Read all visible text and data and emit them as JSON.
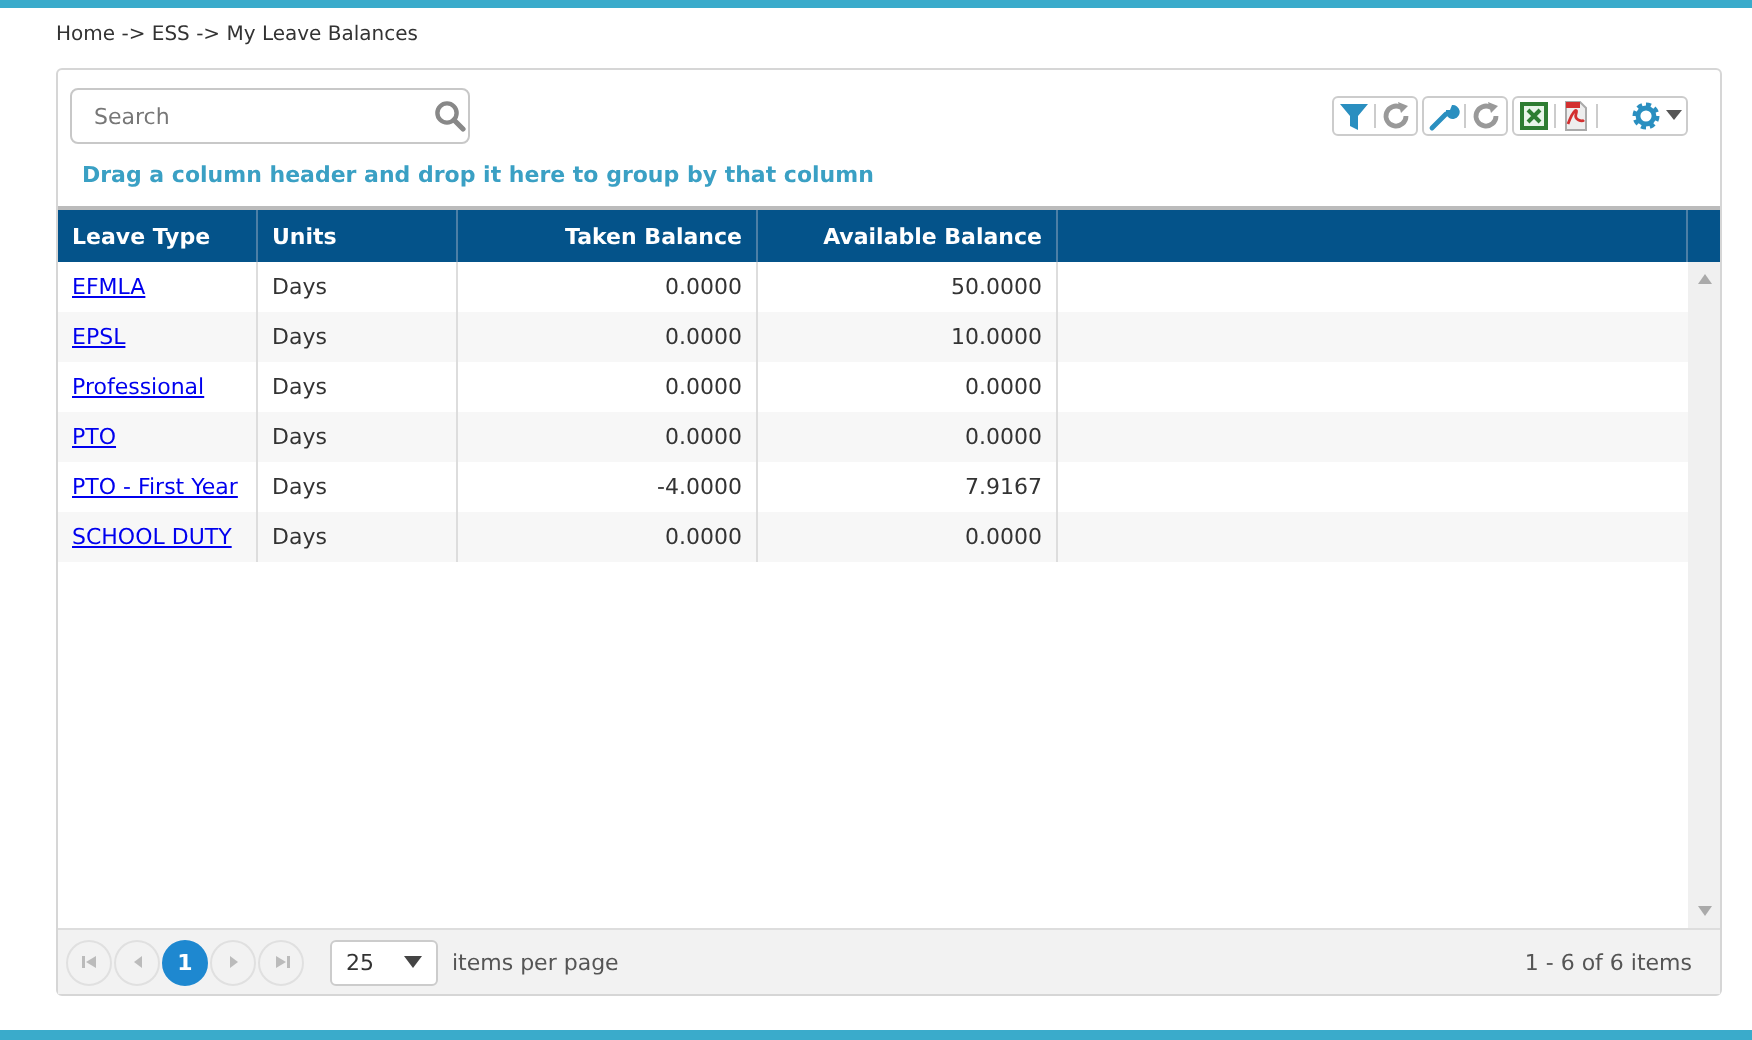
{
  "breadcrumb": "Home -> ESS -> My Leave Balances",
  "search": {
    "placeholder": "Search"
  },
  "group_hint": "Drag a column header and drop it here to group by that column",
  "table": {
    "columns": [
      {
        "label": "Leave Type",
        "numeric": false
      },
      {
        "label": "Units",
        "numeric": false
      },
      {
        "label": "Taken Balance",
        "numeric": true
      },
      {
        "label": "Available Balance",
        "numeric": true
      }
    ],
    "rows": [
      {
        "leave_type": "EFMLA",
        "units": "Days",
        "taken": "0.0000",
        "available": "50.0000"
      },
      {
        "leave_type": "EPSL",
        "units": "Days",
        "taken": "0.0000",
        "available": "10.0000"
      },
      {
        "leave_type": "Professional",
        "units": "Days",
        "taken": "0.0000",
        "available": "0.0000"
      },
      {
        "leave_type": "PTO",
        "units": "Days",
        "taken": "0.0000",
        "available": "0.0000"
      },
      {
        "leave_type": "PTO - First Year",
        "units": "Days",
        "taken": "-4.0000",
        "available": "7.9167"
      },
      {
        "leave_type": "SCHOOL DUTY",
        "units": "Days",
        "taken": "0.0000",
        "available": "0.0000"
      }
    ]
  },
  "pager": {
    "pages": [
      {
        "label": "1",
        "selected": true
      }
    ],
    "page_size": "25",
    "page_size_label": "items per page",
    "summary": "1 - 6 of 6 items"
  }
}
